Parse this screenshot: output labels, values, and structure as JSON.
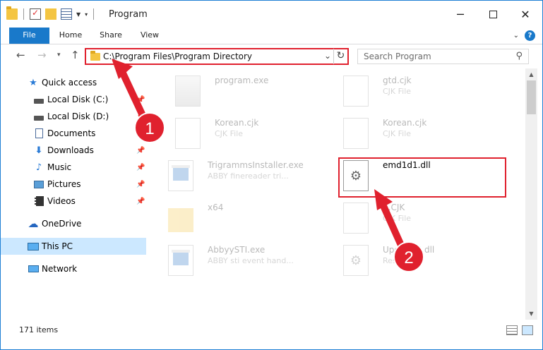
{
  "window": {
    "title": "Program",
    "controls": {
      "minimize": "─",
      "close": "✕"
    }
  },
  "ribbon": {
    "tabs": [
      "File",
      "Home",
      "Share",
      "View"
    ],
    "help": "?"
  },
  "address": {
    "path": "C:\\Program Files\\Program Directory",
    "highlight_color": "#e0212e"
  },
  "search": {
    "placeholder": "Search Program"
  },
  "sidebar": {
    "items": [
      {
        "label": "Quick access",
        "icon": "star-icon",
        "pinned": false
      },
      {
        "label": "Local Disk (C:)",
        "icon": "drive-icon",
        "pinned": true
      },
      {
        "label": "Local Disk (D:)",
        "icon": "drive-icon",
        "pinned": true
      },
      {
        "label": "Documents",
        "icon": "documents-icon",
        "pinned": true
      },
      {
        "label": "Downloads",
        "icon": "downloads-icon",
        "pinned": true
      },
      {
        "label": "Music",
        "icon": "music-icon",
        "pinned": true
      },
      {
        "label": "Pictures",
        "icon": "pictures-icon",
        "pinned": true
      },
      {
        "label": "Videos",
        "icon": "videos-icon",
        "pinned": true
      },
      {
        "label": "OneDrive",
        "icon": "onedrive-icon",
        "pinned": false
      },
      {
        "label": "This PC",
        "icon": "this-pc-icon",
        "selected": true
      },
      {
        "label": "Network",
        "icon": "network-icon",
        "pinned": false
      }
    ]
  },
  "files": [
    {
      "name": "program.exe",
      "type": "",
      "icon": "program-icon",
      "faded": true
    },
    {
      "name": "gtd.cjk",
      "type": "CJK File",
      "icon": "document-icon",
      "faded": true
    },
    {
      "name": "Korean.cjk",
      "type": "CJK File",
      "icon": "document-icon",
      "faded": true
    },
    {
      "name": "Korean.cjk",
      "type": "CJK File",
      "icon": "document-icon",
      "faded": true
    },
    {
      "name": "TrigrammsInstaller.exe",
      "type": "ABBY finereader tri...",
      "icon": "exe-icon",
      "faded": true
    },
    {
      "name": "emd1d1.dll",
      "type": "",
      "icon": "dll-gear-icon",
      "faded": false,
      "highlighted": true
    },
    {
      "name": "x64",
      "type": "",
      "icon": "folder-icon",
      "faded": true
    },
    {
      "name": "...CJK",
      "type": "CJK File",
      "icon": "document-icon",
      "faded": true
    },
    {
      "name": "AbbyySTI.exe",
      "type": "ABBY sti event hand...",
      "icon": "exe-icon",
      "faded": true
    },
    {
      "name": "Upda...t5.dll",
      "type": "Reso...L",
      "icon": "dll-gear-icon",
      "faded": true
    }
  ],
  "status": {
    "item_count": "171 items"
  },
  "annotations": [
    {
      "number": "1",
      "color": "#e0212e"
    },
    {
      "number": "2",
      "color": "#e0212e"
    }
  ]
}
